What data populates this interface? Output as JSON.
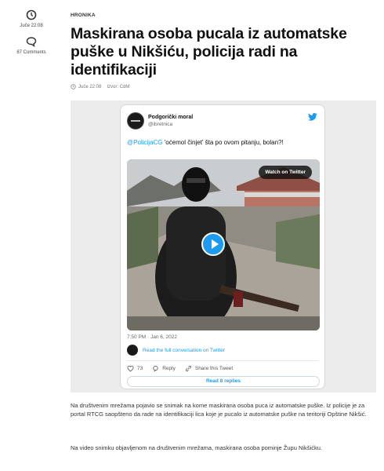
{
  "sidebar": {
    "time": "Juče 22:08",
    "comments": "87 Comments"
  },
  "article": {
    "category": "HRONIKA",
    "title": "Maskirana osoba pucala iz automatske puške u Nikšiću, policija radi na identifikaciji",
    "meta_time": "Juče 22:08",
    "meta_source": "Izvor: CdM",
    "paragraphs": [
      "Na društvenim mrežama pojavio se snimak na kome maskirana osoba puca iz automatske puške. Iz policije je za portal RTCG saopšteno da rade na identifikaciji lica koje je pucalo iz automatske puške na teritoriji Opštine Nikšić.",
      "Na video snimku objavljenom na društvenim mrežama, maskirana osoba pominje Župu Nikšićku."
    ]
  },
  "tweet": {
    "name": "Podgorički moral",
    "handle": "@ibretnica",
    "mention": "@PolicijaCG",
    "text": " 'oćemol činjet' šta po ovom pitanju, bolan?!",
    "watch_label": "Watch on Twitter",
    "date": "7:50 PM · Jan 6, 2022",
    "conversation_link": "Read the full conversation on Twitter",
    "likes": "73",
    "reply_label": "Reply",
    "share_label": "Share this Tweet",
    "replies_button": "Read 8 replies"
  },
  "colors": {
    "twitter_blue": "#1d9bf0",
    "embed_background": "#ebebeb"
  }
}
